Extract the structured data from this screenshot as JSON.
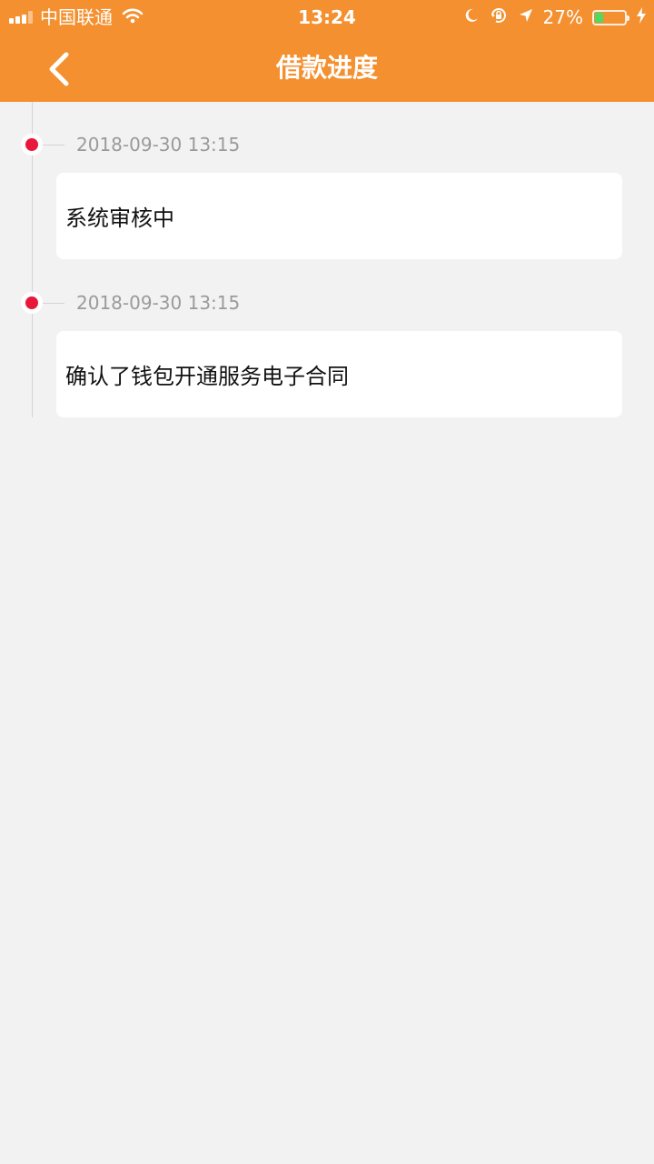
{
  "status_bar": {
    "carrier": "中国联通",
    "time": "13:24",
    "battery_percent": "27%",
    "battery_level": 0.27,
    "icons": [
      "signal-icon",
      "wifi-icon",
      "moon-icon",
      "orientation-lock-icon",
      "location-arrow-icon",
      "battery-icon",
      "charging-bolt-icon"
    ]
  },
  "nav": {
    "title": "借款进度",
    "back_icon": "chevron-left-icon"
  },
  "timeline": {
    "items": [
      {
        "time": "2018-09-30 13:15",
        "text": "系统审核中"
      },
      {
        "time": "2018-09-30 13:15",
        "text": "确认了钱包开通服务电子合同"
      }
    ]
  },
  "colors": {
    "accent": "#f4902f",
    "background": "#f2f2f3",
    "dot": "#e8183b",
    "time_text": "#9a9a9c",
    "line": "#d4d4d6"
  }
}
